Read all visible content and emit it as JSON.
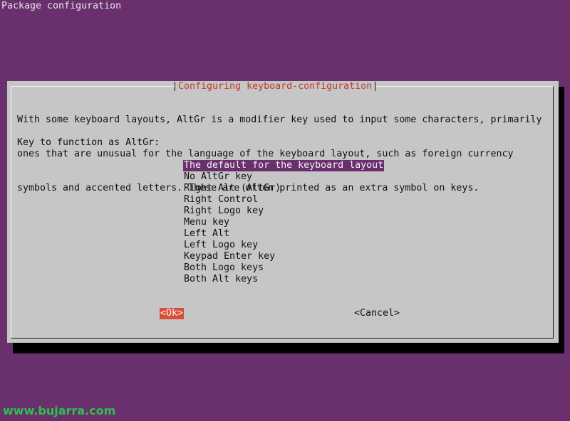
{
  "backtitle": "Package configuration",
  "dialog": {
    "title": "Configuring keyboard-configuration",
    "prompt_lines": [
      "With some keyboard layouts, AltGr is a modifier key used to input some characters, primarily",
      "ones that are unusual for the language of the keyboard layout, such as foreign currency",
      "symbols and accented letters. These are often printed as an extra symbol on keys."
    ],
    "question": "Key to function as AltGr:",
    "options": [
      "The default for the keyboard layout",
      "No AltGr key",
      "Right Alt (AltGr)",
      "Right Control",
      "Right Logo key",
      "Menu key",
      "Left Alt",
      "Left Logo key",
      "Keypad Enter key",
      "Both Logo keys",
      "Both Alt keys"
    ],
    "selected_option": "The default for the keyboard layout",
    "ok_label": "<Ok>",
    "cancel_label": "<Cancel>"
  },
  "watermark": "www.bujarra.com",
  "colors": {
    "background": "#6a2f6d",
    "dialog": "#c6c6c6",
    "title": "#c03a2b",
    "selection": "#6a2f6d",
    "ok_button": "#d84f39",
    "watermark": "#2cc24a"
  }
}
